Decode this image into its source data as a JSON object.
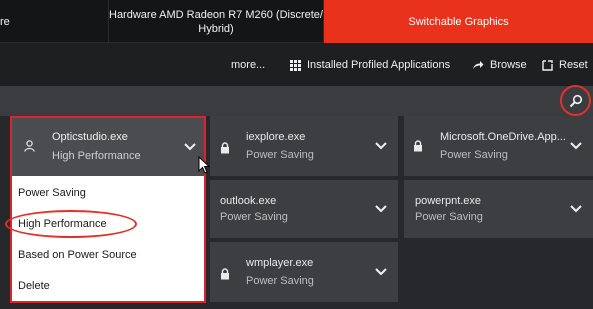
{
  "tabs": [
    {
      "label": "re",
      "active": false
    },
    {
      "label": "Hardware AMD Radeon R7 M260 (Discrete/\nHybrid)",
      "active": false
    },
    {
      "label": "Switchable Graphics",
      "active": true
    }
  ],
  "colors": {
    "accent": "#e8321b",
    "highlight_ring": "#e0322a"
  },
  "toolbar": {
    "more_label": "more...",
    "installed_label": "Installed Profiled Applications",
    "browse_label": "Browse",
    "reset_label": "Reset",
    "icons": [
      "grid-icon",
      "share-arrow-icon",
      "reset-icon"
    ]
  },
  "search": {
    "icon": "search-icon"
  },
  "expanded_app": {
    "name": "Opticstudio.exe",
    "mode": "High Performance",
    "options": [
      "Power Saving",
      "High Performance",
      "Based on Power Source",
      "Delete"
    ],
    "highlighted_option": "High Performance"
  },
  "apps": [
    {
      "name": "iexplore.exe",
      "mode": "Power Saving",
      "locked": true
    },
    {
      "name": "Microsoft.OneDrive.App...",
      "mode": "Power Saving",
      "locked": true
    },
    {
      "name": "outlook.exe",
      "mode": "Power Saving",
      "locked": false
    },
    {
      "name": "powerpnt.exe",
      "mode": "Power Saving",
      "locked": false
    },
    {
      "name": "wmplayer.exe",
      "mode": "Power Saving",
      "locked": true
    }
  ]
}
